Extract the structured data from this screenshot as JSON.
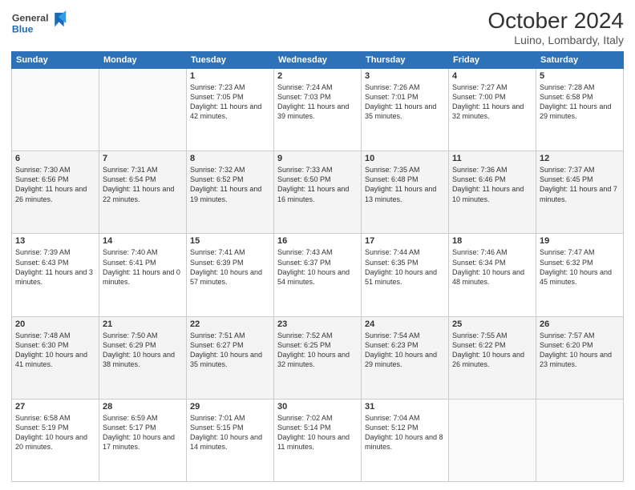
{
  "logo": {
    "line1": "General",
    "line2": "Blue"
  },
  "header": {
    "month": "October 2024",
    "location": "Luino, Lombardy, Italy"
  },
  "days_of_week": [
    "Sunday",
    "Monday",
    "Tuesday",
    "Wednesday",
    "Thursday",
    "Friday",
    "Saturday"
  ],
  "weeks": [
    [
      {
        "day": "",
        "sunrise": "",
        "sunset": "",
        "daylight": ""
      },
      {
        "day": "",
        "sunrise": "",
        "sunset": "",
        "daylight": ""
      },
      {
        "day": "1",
        "sunrise": "Sunrise: 7:23 AM",
        "sunset": "Sunset: 7:05 PM",
        "daylight": "Daylight: 11 hours and 42 minutes."
      },
      {
        "day": "2",
        "sunrise": "Sunrise: 7:24 AM",
        "sunset": "Sunset: 7:03 PM",
        "daylight": "Daylight: 11 hours and 39 minutes."
      },
      {
        "day": "3",
        "sunrise": "Sunrise: 7:26 AM",
        "sunset": "Sunset: 7:01 PM",
        "daylight": "Daylight: 11 hours and 35 minutes."
      },
      {
        "day": "4",
        "sunrise": "Sunrise: 7:27 AM",
        "sunset": "Sunset: 7:00 PM",
        "daylight": "Daylight: 11 hours and 32 minutes."
      },
      {
        "day": "5",
        "sunrise": "Sunrise: 7:28 AM",
        "sunset": "Sunset: 6:58 PM",
        "daylight": "Daylight: 11 hours and 29 minutes."
      }
    ],
    [
      {
        "day": "6",
        "sunrise": "Sunrise: 7:30 AM",
        "sunset": "Sunset: 6:56 PM",
        "daylight": "Daylight: 11 hours and 26 minutes."
      },
      {
        "day": "7",
        "sunrise": "Sunrise: 7:31 AM",
        "sunset": "Sunset: 6:54 PM",
        "daylight": "Daylight: 11 hours and 22 minutes."
      },
      {
        "day": "8",
        "sunrise": "Sunrise: 7:32 AM",
        "sunset": "Sunset: 6:52 PM",
        "daylight": "Daylight: 11 hours and 19 minutes."
      },
      {
        "day": "9",
        "sunrise": "Sunrise: 7:33 AM",
        "sunset": "Sunset: 6:50 PM",
        "daylight": "Daylight: 11 hours and 16 minutes."
      },
      {
        "day": "10",
        "sunrise": "Sunrise: 7:35 AM",
        "sunset": "Sunset: 6:48 PM",
        "daylight": "Daylight: 11 hours and 13 minutes."
      },
      {
        "day": "11",
        "sunrise": "Sunrise: 7:36 AM",
        "sunset": "Sunset: 6:46 PM",
        "daylight": "Daylight: 11 hours and 10 minutes."
      },
      {
        "day": "12",
        "sunrise": "Sunrise: 7:37 AM",
        "sunset": "Sunset: 6:45 PM",
        "daylight": "Daylight: 11 hours and 7 minutes."
      }
    ],
    [
      {
        "day": "13",
        "sunrise": "Sunrise: 7:39 AM",
        "sunset": "Sunset: 6:43 PM",
        "daylight": "Daylight: 11 hours and 3 minutes."
      },
      {
        "day": "14",
        "sunrise": "Sunrise: 7:40 AM",
        "sunset": "Sunset: 6:41 PM",
        "daylight": "Daylight: 11 hours and 0 minutes."
      },
      {
        "day": "15",
        "sunrise": "Sunrise: 7:41 AM",
        "sunset": "Sunset: 6:39 PM",
        "daylight": "Daylight: 10 hours and 57 minutes."
      },
      {
        "day": "16",
        "sunrise": "Sunrise: 7:43 AM",
        "sunset": "Sunset: 6:37 PM",
        "daylight": "Daylight: 10 hours and 54 minutes."
      },
      {
        "day": "17",
        "sunrise": "Sunrise: 7:44 AM",
        "sunset": "Sunset: 6:35 PM",
        "daylight": "Daylight: 10 hours and 51 minutes."
      },
      {
        "day": "18",
        "sunrise": "Sunrise: 7:46 AM",
        "sunset": "Sunset: 6:34 PM",
        "daylight": "Daylight: 10 hours and 48 minutes."
      },
      {
        "day": "19",
        "sunrise": "Sunrise: 7:47 AM",
        "sunset": "Sunset: 6:32 PM",
        "daylight": "Daylight: 10 hours and 45 minutes."
      }
    ],
    [
      {
        "day": "20",
        "sunrise": "Sunrise: 7:48 AM",
        "sunset": "Sunset: 6:30 PM",
        "daylight": "Daylight: 10 hours and 41 minutes."
      },
      {
        "day": "21",
        "sunrise": "Sunrise: 7:50 AM",
        "sunset": "Sunset: 6:29 PM",
        "daylight": "Daylight: 10 hours and 38 minutes."
      },
      {
        "day": "22",
        "sunrise": "Sunrise: 7:51 AM",
        "sunset": "Sunset: 6:27 PM",
        "daylight": "Daylight: 10 hours and 35 minutes."
      },
      {
        "day": "23",
        "sunrise": "Sunrise: 7:52 AM",
        "sunset": "Sunset: 6:25 PM",
        "daylight": "Daylight: 10 hours and 32 minutes."
      },
      {
        "day": "24",
        "sunrise": "Sunrise: 7:54 AM",
        "sunset": "Sunset: 6:23 PM",
        "daylight": "Daylight: 10 hours and 29 minutes."
      },
      {
        "day": "25",
        "sunrise": "Sunrise: 7:55 AM",
        "sunset": "Sunset: 6:22 PM",
        "daylight": "Daylight: 10 hours and 26 minutes."
      },
      {
        "day": "26",
        "sunrise": "Sunrise: 7:57 AM",
        "sunset": "Sunset: 6:20 PM",
        "daylight": "Daylight: 10 hours and 23 minutes."
      }
    ],
    [
      {
        "day": "27",
        "sunrise": "Sunrise: 6:58 AM",
        "sunset": "Sunset: 5:19 PM",
        "daylight": "Daylight: 10 hours and 20 minutes."
      },
      {
        "day": "28",
        "sunrise": "Sunrise: 6:59 AM",
        "sunset": "Sunset: 5:17 PM",
        "daylight": "Daylight: 10 hours and 17 minutes."
      },
      {
        "day": "29",
        "sunrise": "Sunrise: 7:01 AM",
        "sunset": "Sunset: 5:15 PM",
        "daylight": "Daylight: 10 hours and 14 minutes."
      },
      {
        "day": "30",
        "sunrise": "Sunrise: 7:02 AM",
        "sunset": "Sunset: 5:14 PM",
        "daylight": "Daylight: 10 hours and 11 minutes."
      },
      {
        "day": "31",
        "sunrise": "Sunrise: 7:04 AM",
        "sunset": "Sunset: 5:12 PM",
        "daylight": "Daylight: 10 hours and 8 minutes."
      },
      {
        "day": "",
        "sunrise": "",
        "sunset": "",
        "daylight": ""
      },
      {
        "day": "",
        "sunrise": "",
        "sunset": "",
        "daylight": ""
      }
    ]
  ]
}
